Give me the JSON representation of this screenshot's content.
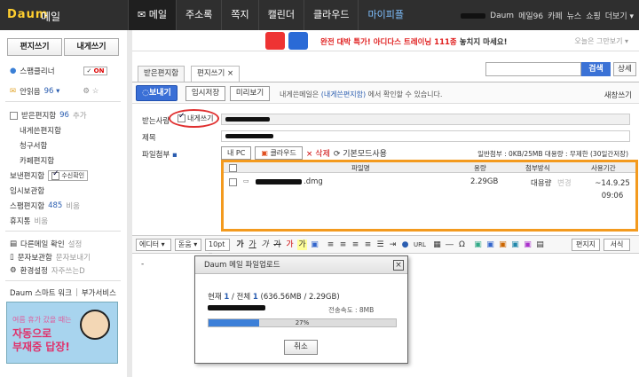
{
  "topbar": {
    "logo": "Daum",
    "service": "메일",
    "nav": [
      "메일",
      "주소록",
      "쪽지",
      "캘린더",
      "클라우드",
      "마이피플"
    ],
    "right": [
      "Daum",
      "메일96",
      "카페",
      "뉴스",
      "쇼핑",
      "더보기 ▾"
    ]
  },
  "sidebar": {
    "write": "편지쓰기",
    "write_self": "내게쓰기",
    "smart_cleaner": "스팸클리너",
    "smart_toggle": "ON",
    "unread_label": "안읽음",
    "unread_count": "96 ▾",
    "inbox": "받은편지함",
    "inbox_count": "96",
    "inbox_add": "추가",
    "folders": [
      "내게쓴편지함",
      "청구서함",
      "카페편지함"
    ],
    "sent": "보낸편지함",
    "receipt": "수신확인",
    "drafts": "임시보관함",
    "spam": "스팸편지함",
    "spam_count": "485",
    "spam_empty": "비움",
    "trash": "휴지통",
    "trash_empty": "비움",
    "other_mail": "다른메일 확인",
    "other_mail_setting": "설정",
    "docs": "문자보관함",
    "docs_write": "문자보내기",
    "env": "환경설정",
    "env_sub": "자주쓰는D",
    "smart_work": "Daum 스마트 워크",
    "addon": "부가서비스",
    "ad_line1": "여름 휴가 갔을 때는",
    "ad_line2a": "자동으로",
    "ad_line2b": "부재중 답장!"
  },
  "banner": {
    "text_a": "완전 대박 특가!",
    "text_b": "아디다스 트레이닝 111종",
    "text_c": "놓치지 마세요!",
    "right": "오늘은 그만보기 ▾"
  },
  "tabs": [
    "받은편지함",
    "편지쓰기 ×"
  ],
  "search": {
    "button": "검색",
    "detail": "상세"
  },
  "toolbar": {
    "send": "보내기",
    "save": "임시저장",
    "preview": "미리보기",
    "note_a": "내게쓴메일은",
    "note_b": "(내게쓴편지함)",
    "note_c": "에서 확인할 수 있습니다.",
    "compose_mode": "새창쓰기"
  },
  "form": {
    "to_label": "받는사람",
    "self_label": "내게쓰기",
    "subject_label": "제목",
    "attach_label": "파일첨부",
    "my_pc": "내 PC",
    "cloud": "클라우드",
    "delete": "× 삭제",
    "basic_mode": "기본모드사용",
    "attach_info": "일반첨부 : 0KB/25MB  대용량 : 무제한 (30일간저장)"
  },
  "files": {
    "headers": [
      "파일명",
      "용량",
      "첨부방식",
      "사용기간"
    ],
    "rows": [
      {
        "name": ".dmg",
        "size": "2.29GB",
        "method": "대용량",
        "change": "변경",
        "period": "~14.9.25 09:06"
      }
    ]
  },
  "editor": {
    "font": "에디터",
    "font_face": "돋움",
    "font_size": "10pt",
    "url": "URL",
    "mode_btn": "편지지",
    "style_btn": "서식",
    "cursor": "-"
  },
  "dialog": {
    "title": "Daum 메일 파일업로드",
    "current_label": "현재",
    "current": "1",
    "total_label": "/ 전체",
    "total": "1",
    "sizes": "(636.56MB / 2.29GB)",
    "speed": "전송속도 : 8MB",
    "progress": 27,
    "progress_text": "27%",
    "cancel": "취소"
  }
}
